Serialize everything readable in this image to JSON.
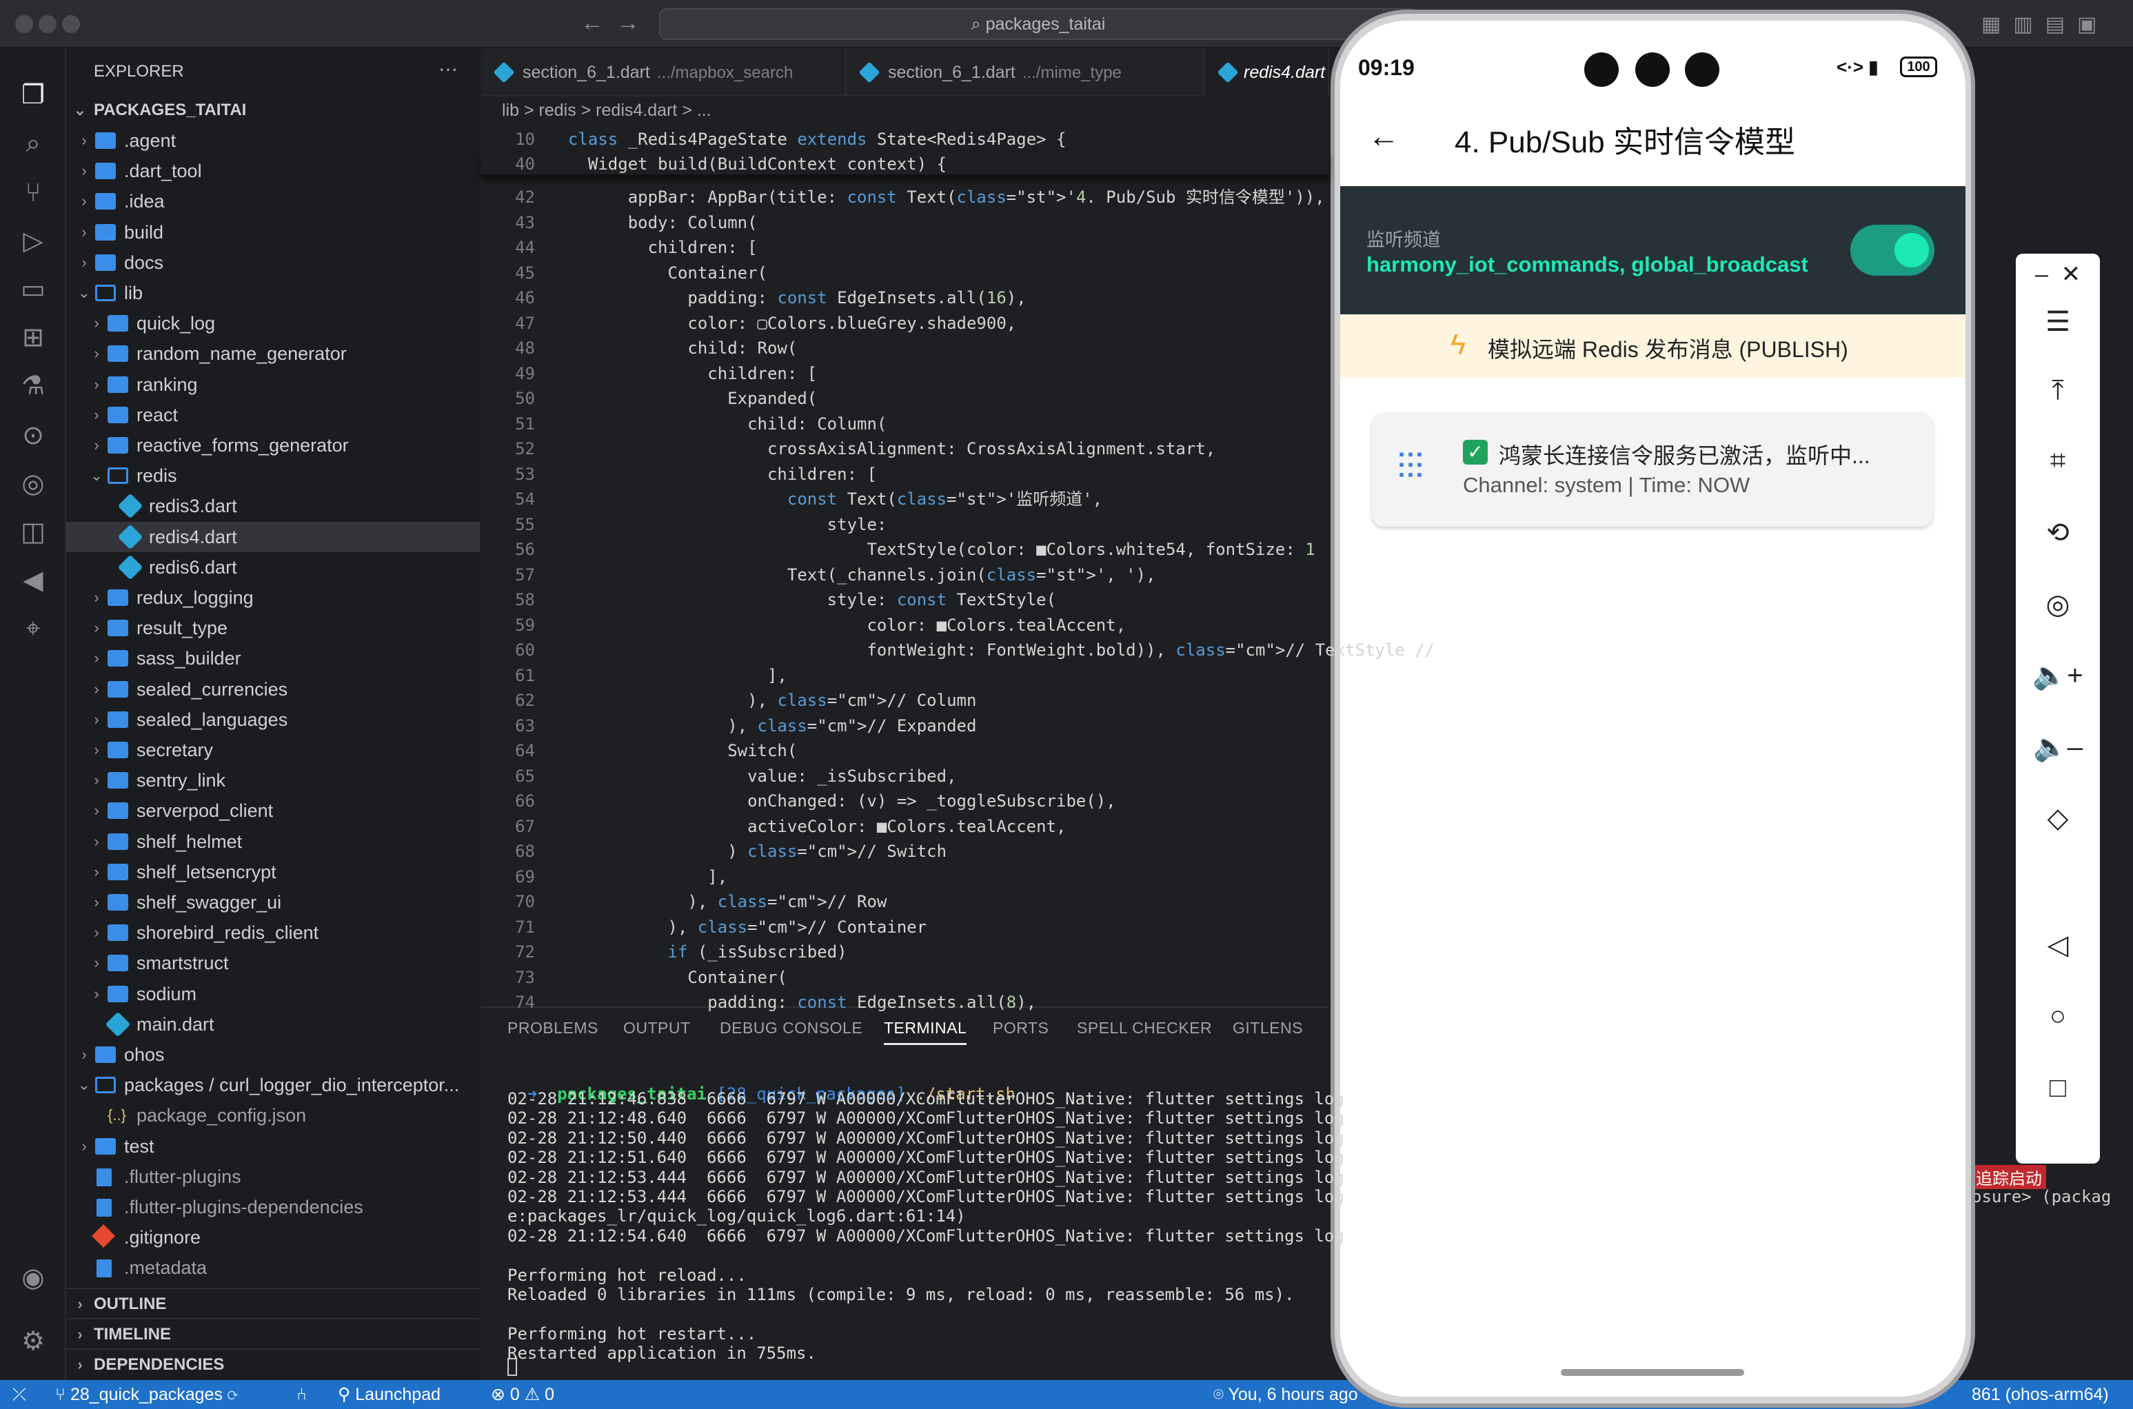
{
  "window": {
    "title": "packages_taitai"
  },
  "explorer": {
    "title": "EXPLORER",
    "root": "PACKAGES_TAITAI",
    "items": [
      {
        "label": ".agent",
        "type": "folder",
        "depth": 1
      },
      {
        "label": ".dart_tool",
        "type": "folder",
        "depth": 1
      },
      {
        "label": ".idea",
        "type": "folder",
        "depth": 1
      },
      {
        "label": "build",
        "type": "folder",
        "depth": 1
      },
      {
        "label": "docs",
        "type": "folder",
        "depth": 1
      },
      {
        "label": "lib",
        "type": "folder-open",
        "depth": 1
      },
      {
        "label": "quick_log",
        "type": "folder",
        "depth": 2
      },
      {
        "label": "random_name_generator",
        "type": "folder",
        "depth": 2
      },
      {
        "label": "ranking",
        "type": "folder",
        "depth": 2
      },
      {
        "label": "react",
        "type": "folder",
        "depth": 2
      },
      {
        "label": "reactive_forms_generator",
        "type": "folder",
        "depth": 2
      },
      {
        "label": "redis",
        "type": "folder-open",
        "depth": 2
      },
      {
        "label": "redis3.dart",
        "type": "dart",
        "depth": 3
      },
      {
        "label": "redis4.dart",
        "type": "dart",
        "depth": 3
      },
      {
        "label": "redis6.dart",
        "type": "dart",
        "depth": 3
      },
      {
        "label": "redux_logging",
        "type": "folder",
        "depth": 2
      },
      {
        "label": "result_type",
        "type": "folder",
        "depth": 2
      },
      {
        "label": "sass_builder",
        "type": "folder",
        "depth": 2
      },
      {
        "label": "sealed_currencies",
        "type": "folder",
        "depth": 2
      },
      {
        "label": "sealed_languages",
        "type": "folder",
        "depth": 2
      },
      {
        "label": "secretary",
        "type": "folder",
        "depth": 2
      },
      {
        "label": "sentry_link",
        "type": "folder",
        "depth": 2
      },
      {
        "label": "serverpod_client",
        "type": "folder",
        "depth": 2
      },
      {
        "label": "shelf_helmet",
        "type": "folder",
        "depth": 2
      },
      {
        "label": "shelf_letsencrypt",
        "type": "folder",
        "depth": 2
      },
      {
        "label": "shelf_swagger_ui",
        "type": "folder",
        "depth": 2
      },
      {
        "label": "shorebird_redis_client",
        "type": "folder",
        "depth": 2
      },
      {
        "label": "smartstruct",
        "type": "folder",
        "depth": 2
      },
      {
        "label": "sodium",
        "type": "folder",
        "depth": 2
      },
      {
        "label": "main.dart",
        "type": "dart",
        "depth": 2
      },
      {
        "label": "ohos",
        "type": "folder",
        "depth": 1
      },
      {
        "label": "packages / curl_logger_dio_interceptor...",
        "type": "folder-open",
        "depth": 1
      },
      {
        "label": "package_config.json",
        "type": "json",
        "depth": 2
      },
      {
        "label": "test",
        "type": "folder",
        "depth": 1
      },
      {
        "label": ".flutter-plugins",
        "type": "file",
        "depth": 1
      },
      {
        "label": ".flutter-plugins-dependencies",
        "type": "file",
        "depth": 1
      },
      {
        "label": ".gitignore",
        "type": "git",
        "depth": 1
      },
      {
        "label": ".metadata",
        "type": "file",
        "depth": 1
      }
    ],
    "sections": [
      "OUTLINE",
      "TIMELINE",
      "DEPENDENCIES"
    ]
  },
  "tabs": [
    {
      "name": "section_6_1.dart",
      "path": ".../mapbox_search"
    },
    {
      "name": "section_6_1.dart",
      "path": ".../mime_type"
    },
    {
      "name": "redis4.dart",
      "path": ""
    }
  ],
  "breadcrumb": "lib > redis > redis4.dart > ...",
  "code": [
    {
      "n": "10",
      "t": "class _Redis4PageState extends State<Redis4Page> {"
    },
    {
      "n": "40",
      "t": "  Widget build(BuildContext context) {"
    },
    {
      "n": "42",
      "t": "      appBar: AppBar(title: const Text('4. Pub/Sub 实时信令模型')),"
    },
    {
      "n": "43",
      "t": "      body: Column("
    },
    {
      "n": "44",
      "t": "        children: ["
    },
    {
      "n": "45",
      "t": "          Container("
    },
    {
      "n": "46",
      "t": "            padding: const EdgeInsets.all(16),"
    },
    {
      "n": "47",
      "t": "            color: ▢Colors.blueGrey.shade900,"
    },
    {
      "n": "48",
      "t": "            child: Row("
    },
    {
      "n": "49",
      "t": "              children: ["
    },
    {
      "n": "50",
      "t": "                Expanded("
    },
    {
      "n": "51",
      "t": "                  child: Column("
    },
    {
      "n": "52",
      "t": "                    crossAxisAlignment: CrossAxisAlignment.start,"
    },
    {
      "n": "53",
      "t": "                    children: ["
    },
    {
      "n": "54",
      "t": "                      const Text('监听频道',"
    },
    {
      "n": "55",
      "t": "                          style:"
    },
    {
      "n": "56",
      "t": "                              TextStyle(color: ■Colors.white54, fontSize: 1"
    },
    {
      "n": "57",
      "t": "                      Text(_channels.join(', '),"
    },
    {
      "n": "58",
      "t": "                          style: const TextStyle("
    },
    {
      "n": "59",
      "t": "                              color: ■Colors.tealAccent,"
    },
    {
      "n": "60",
      "t": "                              fontWeight: FontWeight.bold)), // TextStyle //"
    },
    {
      "n": "61",
      "t": "                    ],"
    },
    {
      "n": "62",
      "t": "                  ), // Column"
    },
    {
      "n": "63",
      "t": "                ), // Expanded"
    },
    {
      "n": "64",
      "t": "                Switch("
    },
    {
      "n": "65",
      "t": "                  value: _isSubscribed,"
    },
    {
      "n": "66",
      "t": "                  onChanged: (v) => _toggleSubscribe(),"
    },
    {
      "n": "67",
      "t": "                  activeColor: ■Colors.tealAccent,"
    },
    {
      "n": "68",
      "t": "                ) // Switch"
    },
    {
      "n": "69",
      "t": "              ],"
    },
    {
      "n": "70",
      "t": "            ), // Row"
    },
    {
      "n": "71",
      "t": "          ), // Container"
    },
    {
      "n": "72",
      "t": "          if (_isSubscribed)"
    },
    {
      "n": "73",
      "t": "            Container("
    },
    {
      "n": "74",
      "t": "              padding: const EdgeInsets.all(8),"
    }
  ],
  "panel_tabs": [
    "PROBLEMS",
    "OUTPUT",
    "DEBUG CONSOLE",
    "TERMINAL",
    "PORTS",
    "SPELL CHECKER",
    "GITLENS"
  ],
  "terminal": {
    "prompt_dir": "packages_taitai",
    "prompt_branch": "[28_quick_packages]",
    "prompt_cmd": "./start.sh",
    "lines": [
      "02-28 21:12:46.838  6666  6797 W A00000/XComFlutterOHOS_Native: flutter settings log",
      "02-28 21:12:48.640  6666  6797 W A00000/XComFlutterOHOS_Native: flutter settings log",
      "02-28 21:12:50.440  6666  6797 W A00000/XComFlutterOHOS_Native: flutter settings log",
      "02-28 21:12:51.640  6666  6797 W A00000/XComFlutterOHOS_Native: flutter settings log",
      "02-28 21:12:53.444  6666  6797 W A00000/XComFlutterOHOS_Native: flutter settings log",
      "02-28 21:12:53.444  6666  6797 W A00000/XComFlutterOHOS_Native: flutter settings log",
      "e:packages_lr/quick_log/quick_log6.dart:61:14)",
      "02-28 21:12:54.640  6666  6797 W A00000/XComFlutterOHOS_Native: flutter settings log",
      "",
      "Performing hot reload...",
      "Reloaded 0 libraries in 111ms (compile: 9 ms, reload: 0 ms, reassemble: 56 ms).",
      "",
      "Performing hot restart...",
      "Restarted application in 755ms."
    ],
    "side_badge": "追踪启动",
    "side_text": "osure> (packag"
  },
  "statusbar": {
    "branch": "28_quick_packages",
    "launch": "Launchpad",
    "errors": "0",
    "warnings": "0",
    "blame": "You, 6 hours ago",
    "device": "861 (ohos-arm64)"
  },
  "phone": {
    "time": "09:19",
    "battery": "100",
    "appbar_title": "4. Pub/Sub 实时信令模型",
    "channel_label": "监听频道",
    "channels": "harmony_iot_commands, global_broadcast",
    "switch_on": true,
    "publish_label": "模拟远端 Redis 发布消息 (PUBLISH)",
    "message_title": "鸿蒙长连接信令服务已激活，监听中...",
    "message_meta": "Channel: system | Time: NOW"
  },
  "colors": {
    "accent": "#1f70c9",
    "teal": "#1de9b6",
    "bluegrey": "#263238"
  }
}
